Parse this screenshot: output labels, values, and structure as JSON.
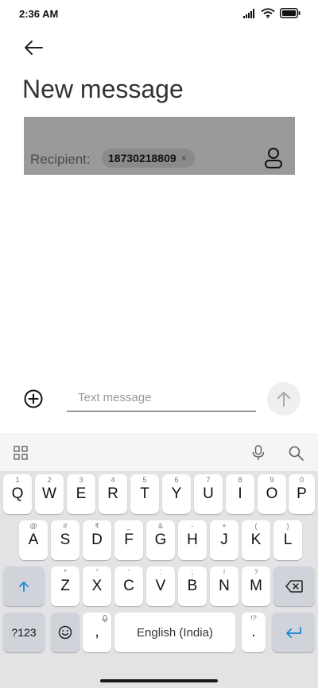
{
  "status_bar": {
    "time": "2:36 AM",
    "icons": [
      "signal-icon",
      "wifi-icon",
      "battery-icon"
    ]
  },
  "header": {
    "back_icon": "arrow-left-icon",
    "title": "New message"
  },
  "recipient": {
    "label": "Recipient:",
    "chip_number": "18730218809",
    "chip_remove": "×",
    "contact_icon": "person-icon"
  },
  "compose": {
    "add_icon": "plus-circle-icon",
    "placeholder": "Text message",
    "value": "",
    "send_icon": "arrow-up-icon"
  },
  "keyboard": {
    "toolbar_icons": [
      "grid-icon",
      "mic-icon",
      "search-icon"
    ],
    "row1": [
      {
        "key": "Q",
        "hint": "1"
      },
      {
        "key": "W",
        "hint": "2"
      },
      {
        "key": "E",
        "hint": "3"
      },
      {
        "key": "R",
        "hint": "4"
      },
      {
        "key": "T",
        "hint": "5"
      },
      {
        "key": "Y",
        "hint": "6"
      },
      {
        "key": "U",
        "hint": "7"
      },
      {
        "key": "I",
        "hint": "8"
      },
      {
        "key": "O",
        "hint": "9"
      },
      {
        "key": "P",
        "hint": "0"
      }
    ],
    "row2": [
      {
        "key": "A",
        "hint": "@"
      },
      {
        "key": "S",
        "hint": "#"
      },
      {
        "key": "D",
        "hint": "₹"
      },
      {
        "key": "F",
        "hint": "_"
      },
      {
        "key": "G",
        "hint": "&"
      },
      {
        "key": "H",
        "hint": "-"
      },
      {
        "key": "J",
        "hint": "+"
      },
      {
        "key": "K",
        "hint": "("
      },
      {
        "key": "L",
        "hint": ")"
      }
    ],
    "row3": [
      {
        "key": "Z",
        "hint": "*"
      },
      {
        "key": "X",
        "hint": "\""
      },
      {
        "key": "C",
        "hint": "'"
      },
      {
        "key": "V",
        "hint": ":"
      },
      {
        "key": "B",
        "hint": ";"
      },
      {
        "key": "N",
        "hint": "!"
      },
      {
        "key": "M",
        "hint": "?"
      }
    ],
    "shift_icon": "shift-arrow-icon",
    "backspace_icon": "backspace-icon",
    "symbols_key": "?123",
    "emoji_icon": "smiley-icon",
    "comma_key": ",",
    "space_label": "English (India)",
    "period_key": ".",
    "period_hint": "!?",
    "enter_icon": "enter-icon",
    "accent_color": "#1a87d6"
  }
}
